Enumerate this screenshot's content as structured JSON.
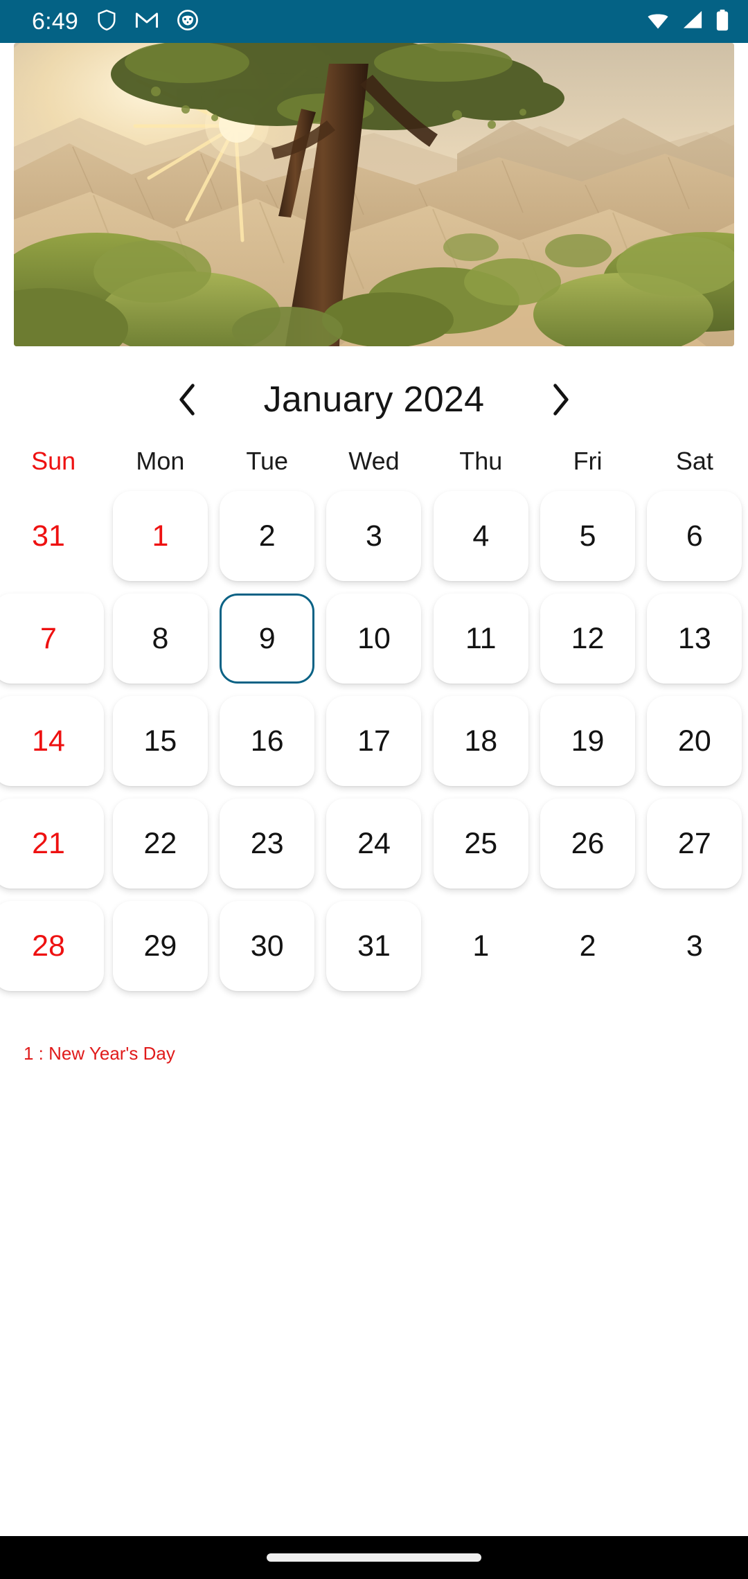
{
  "status_bar": {
    "time": "6:49",
    "left_icons": [
      "shield-icon",
      "gmail-icon",
      "frog-app-icon"
    ],
    "right_icons": [
      "wifi-icon",
      "cellular-signal-icon",
      "battery-icon"
    ],
    "background_color": "#046285"
  },
  "hero": {
    "alt": "desert-landscape-sunrise-photo"
  },
  "header": {
    "prev_label": "‹",
    "next_label": "›",
    "title": "January 2024"
  },
  "weekdays": [
    {
      "label": "Sun",
      "color": "#ee1111"
    },
    {
      "label": "Mon",
      "color": "#1b1b1b"
    },
    {
      "label": "Tue",
      "color": "#1b1b1b"
    },
    {
      "label": "Wed",
      "color": "#1b1b1b"
    },
    {
      "label": "Thu",
      "color": "#1b1b1b"
    },
    {
      "label": "Fri",
      "color": "#1b1b1b"
    },
    {
      "label": "Sat",
      "color": "#1b1b1b"
    }
  ],
  "calendar": {
    "selected_day": "9",
    "selected_border_color": "#0a6285",
    "weeks": [
      [
        {
          "day": "31",
          "muted": true,
          "sunday": true,
          "card": false,
          "selected": false
        },
        {
          "day": "1",
          "muted": false,
          "sunday": true,
          "card": true,
          "selected": false
        },
        {
          "day": "2",
          "muted": false,
          "sunday": false,
          "card": true,
          "selected": false
        },
        {
          "day": "3",
          "muted": false,
          "sunday": false,
          "card": true,
          "selected": false
        },
        {
          "day": "4",
          "muted": false,
          "sunday": false,
          "card": true,
          "selected": false
        },
        {
          "day": "5",
          "muted": false,
          "sunday": false,
          "card": true,
          "selected": false
        },
        {
          "day": "6",
          "muted": false,
          "sunday": false,
          "card": true,
          "selected": false
        }
      ],
      [
        {
          "day": "7",
          "muted": false,
          "sunday": true,
          "card": true,
          "selected": false
        },
        {
          "day": "8",
          "muted": false,
          "sunday": false,
          "card": true,
          "selected": false
        },
        {
          "day": "9",
          "muted": false,
          "sunday": false,
          "card": true,
          "selected": true
        },
        {
          "day": "10",
          "muted": false,
          "sunday": false,
          "card": true,
          "selected": false
        },
        {
          "day": "11",
          "muted": false,
          "sunday": false,
          "card": true,
          "selected": false
        },
        {
          "day": "12",
          "muted": false,
          "sunday": false,
          "card": true,
          "selected": false
        },
        {
          "day": "13",
          "muted": false,
          "sunday": false,
          "card": true,
          "selected": false
        }
      ],
      [
        {
          "day": "14",
          "muted": false,
          "sunday": true,
          "card": true,
          "selected": false
        },
        {
          "day": "15",
          "muted": false,
          "sunday": false,
          "card": true,
          "selected": false
        },
        {
          "day": "16",
          "muted": false,
          "sunday": false,
          "card": true,
          "selected": false
        },
        {
          "day": "17",
          "muted": false,
          "sunday": false,
          "card": true,
          "selected": false
        },
        {
          "day": "18",
          "muted": false,
          "sunday": false,
          "card": true,
          "selected": false
        },
        {
          "day": "19",
          "muted": false,
          "sunday": false,
          "card": true,
          "selected": false
        },
        {
          "day": "20",
          "muted": false,
          "sunday": false,
          "card": true,
          "selected": false
        }
      ],
      [
        {
          "day": "21",
          "muted": false,
          "sunday": true,
          "card": true,
          "selected": false
        },
        {
          "day": "22",
          "muted": false,
          "sunday": false,
          "card": true,
          "selected": false
        },
        {
          "day": "23",
          "muted": false,
          "sunday": false,
          "card": true,
          "selected": false
        },
        {
          "day": "24",
          "muted": false,
          "sunday": false,
          "card": true,
          "selected": false
        },
        {
          "day": "25",
          "muted": false,
          "sunday": false,
          "card": true,
          "selected": false
        },
        {
          "day": "26",
          "muted": false,
          "sunday": false,
          "card": true,
          "selected": false
        },
        {
          "day": "27",
          "muted": false,
          "sunday": false,
          "card": true,
          "selected": false
        }
      ],
      [
        {
          "day": "28",
          "muted": false,
          "sunday": true,
          "card": true,
          "selected": false
        },
        {
          "day": "29",
          "muted": false,
          "sunday": false,
          "card": true,
          "selected": false
        },
        {
          "day": "30",
          "muted": false,
          "sunday": false,
          "card": true,
          "selected": false
        },
        {
          "day": "31",
          "muted": false,
          "sunday": false,
          "card": true,
          "selected": false
        },
        {
          "day": "1",
          "muted": true,
          "sunday": false,
          "card": false,
          "selected": false
        },
        {
          "day": "2",
          "muted": true,
          "sunday": false,
          "card": false,
          "selected": false
        },
        {
          "day": "3",
          "muted": true,
          "sunday": false,
          "card": false,
          "selected": false
        }
      ]
    ]
  },
  "holidays": [
    {
      "text": "1 : New Year's Day",
      "color": "#e01b1b"
    }
  ],
  "gesture_bar": {
    "pill": "home-indicator"
  }
}
